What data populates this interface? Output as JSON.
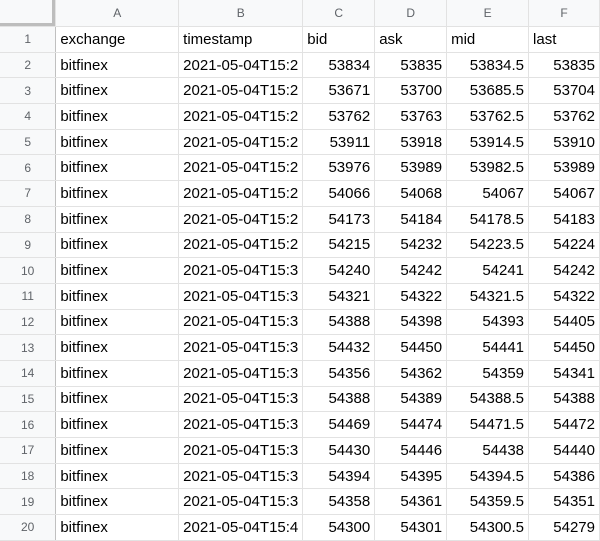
{
  "columns": [
    "A",
    "B",
    "C",
    "D",
    "E",
    "F"
  ],
  "rows": [
    {
      "n": "1",
      "cells": [
        "exchange",
        "timestamp",
        "bid",
        "ask",
        "mid",
        "last"
      ]
    },
    {
      "n": "2",
      "cells": [
        "bitfinex",
        "2021-05-04T15:2",
        "53834",
        "53835",
        "53834.5",
        "53835"
      ]
    },
    {
      "n": "3",
      "cells": [
        "bitfinex",
        "2021-05-04T15:2",
        "53671",
        "53700",
        "53685.5",
        "53704"
      ]
    },
    {
      "n": "4",
      "cells": [
        "bitfinex",
        "2021-05-04T15:2",
        "53762",
        "53763",
        "53762.5",
        "53762"
      ]
    },
    {
      "n": "5",
      "cells": [
        "bitfinex",
        "2021-05-04T15:2",
        "53911",
        "53918",
        "53914.5",
        "53910"
      ]
    },
    {
      "n": "6",
      "cells": [
        "bitfinex",
        "2021-05-04T15:2",
        "53976",
        "53989",
        "53982.5",
        "53989"
      ]
    },
    {
      "n": "7",
      "cells": [
        "bitfinex",
        "2021-05-04T15:2",
        "54066",
        "54068",
        "54067",
        "54067"
      ]
    },
    {
      "n": "8",
      "cells": [
        "bitfinex",
        "2021-05-04T15:2",
        "54173",
        "54184",
        "54178.5",
        "54183"
      ]
    },
    {
      "n": "9",
      "cells": [
        "bitfinex",
        "2021-05-04T15:2",
        "54215",
        "54232",
        "54223.5",
        "54224"
      ]
    },
    {
      "n": "10",
      "cells": [
        "bitfinex",
        "2021-05-04T15:3",
        "54240",
        "54242",
        "54241",
        "54242"
      ]
    },
    {
      "n": "11",
      "cells": [
        "bitfinex",
        "2021-05-04T15:3",
        "54321",
        "54322",
        "54321.5",
        "54322"
      ]
    },
    {
      "n": "12",
      "cells": [
        "bitfinex",
        "2021-05-04T15:3",
        "54388",
        "54398",
        "54393",
        "54405"
      ]
    },
    {
      "n": "13",
      "cells": [
        "bitfinex",
        "2021-05-04T15:3",
        "54432",
        "54450",
        "54441",
        "54450"
      ]
    },
    {
      "n": "14",
      "cells": [
        "bitfinex",
        "2021-05-04T15:3",
        "54356",
        "54362",
        "54359",
        "54341"
      ]
    },
    {
      "n": "15",
      "cells": [
        "bitfinex",
        "2021-05-04T15:3",
        "54388",
        "54389",
        "54388.5",
        "54388"
      ]
    },
    {
      "n": "16",
      "cells": [
        "bitfinex",
        "2021-05-04T15:3",
        "54469",
        "54474",
        "54471.5",
        "54472"
      ]
    },
    {
      "n": "17",
      "cells": [
        "bitfinex",
        "2021-05-04T15:3",
        "54430",
        "54446",
        "54438",
        "54440"
      ]
    },
    {
      "n": "18",
      "cells": [
        "bitfinex",
        "2021-05-04T15:3",
        "54394",
        "54395",
        "54394.5",
        "54386"
      ]
    },
    {
      "n": "19",
      "cells": [
        "bitfinex",
        "2021-05-04T15:3",
        "54358",
        "54361",
        "54359.5",
        "54351"
      ]
    },
    {
      "n": "20",
      "cells": [
        "bitfinex",
        "2021-05-04T15:4",
        "54300",
        "54301",
        "54300.5",
        "54279"
      ]
    }
  ]
}
